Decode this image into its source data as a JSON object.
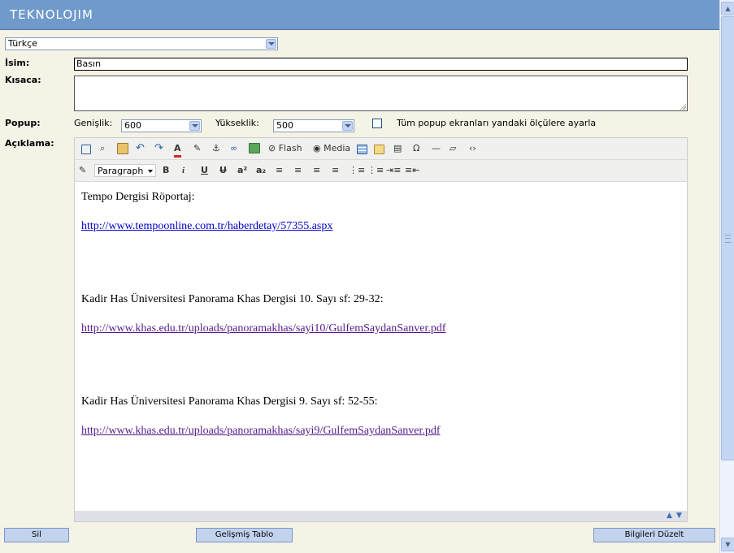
{
  "brand": "TEKNOLOJIM",
  "language_select": {
    "value": "Türkçe"
  },
  "labels": {
    "name": "İsim:",
    "short": "Kısaca:",
    "popup": "Popup:",
    "description": "Açıklama:",
    "width": "Genişlik:",
    "height": "Yükseklik:",
    "apply_all": "Tüm popup ekranları yandaki ölçülere ayarla"
  },
  "fields": {
    "name_value": "Basın",
    "short_value": "",
    "popup_width": "600",
    "popup_height": "500",
    "apply_all_checked": false
  },
  "toolbar": {
    "flash_label": "Flash",
    "media_label": "Media",
    "format_select": "Paragraph",
    "bold": "B",
    "italic": "i",
    "underline": "U",
    "strike": "U",
    "superscript": "a²",
    "subscript": "a₂",
    "omega": "Ω",
    "source": "‹›"
  },
  "content": {
    "p1": "Tempo Dergisi Röportaj:",
    "link1": "http://www.tempoonline.com.tr/haberdetay/57355.aspx",
    "p2": "Kadir Has Üniversitesi Panorama Khas Dergisi 10. Sayı sf: 29-32:",
    "link2": "http://www.khas.edu.tr/uploads/panoramakhas/sayi10/GulfemSaydanSanver.pdf",
    "p3": "Kadir Has Üniversitesi Panorama Khas Dergisi 9. Sayı sf: 52-55:",
    "link3": "http://www.khas.edu.tr/uploads/panoramakhas/sayi9/GulfemSaydanSanver.pdf"
  },
  "buttons": {
    "delete": "Sil",
    "advanced_table": "Gelişmiş Tablo",
    "update": "Bilgileri Düzelt"
  }
}
